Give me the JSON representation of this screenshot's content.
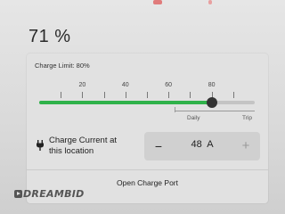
{
  "charge": {
    "percent_text": "71 %"
  },
  "charge_limit": {
    "label": "Charge Limit: 80%",
    "value_percent": 80,
    "scale_ticks": [
      "20",
      "40",
      "60",
      "80"
    ],
    "range_labels": {
      "daily": "Daily",
      "trip": "Trip"
    }
  },
  "charge_current": {
    "label_line1": "Charge Current at",
    "label_line2": "this location",
    "minus_label": "−",
    "value_text": "48  A",
    "plus_label": "+"
  },
  "charge_port": {
    "button_label": "Open Charge Port"
  },
  "watermark": {
    "text": "DREAMBID"
  },
  "colors": {
    "fill_green": "#2fb24a",
    "accent_red": "#d9363e"
  },
  "icons": [
    "plug-icon",
    "watermark-logo-icon"
  ]
}
